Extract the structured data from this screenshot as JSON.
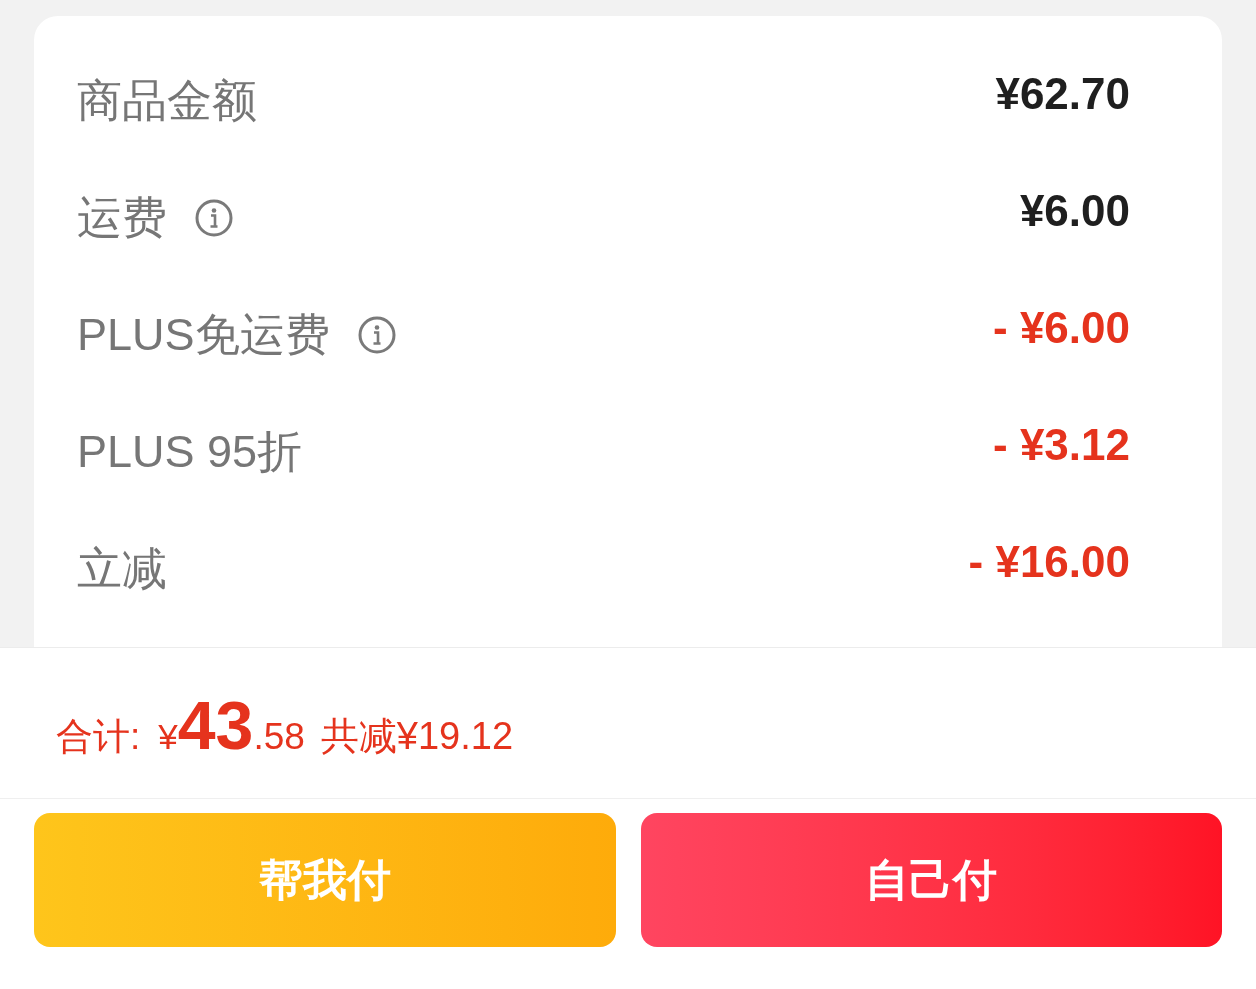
{
  "price_rows": [
    {
      "label": "商品金额",
      "info": false,
      "kind": "charge",
      "amount": "¥62.70"
    },
    {
      "label": "运费",
      "info": true,
      "kind": "charge",
      "amount": "¥6.00"
    },
    {
      "label": "PLUS免运费",
      "info": true,
      "kind": "discount",
      "amount": "- ¥6.00"
    },
    {
      "label": "PLUS 95折",
      "info": false,
      "kind": "discount",
      "amount": "- ¥3.12"
    },
    {
      "label": "立减",
      "info": false,
      "kind": "discount",
      "amount": "- ¥16.00"
    }
  ],
  "total": {
    "label": "合计:",
    "currency": "¥",
    "integer": "43",
    "decimal": ".58",
    "savings": "共减¥19.12"
  },
  "buttons": [
    {
      "label": "帮我付",
      "kind": "secondary"
    },
    {
      "label": "自己付",
      "kind": "primary"
    }
  ]
}
